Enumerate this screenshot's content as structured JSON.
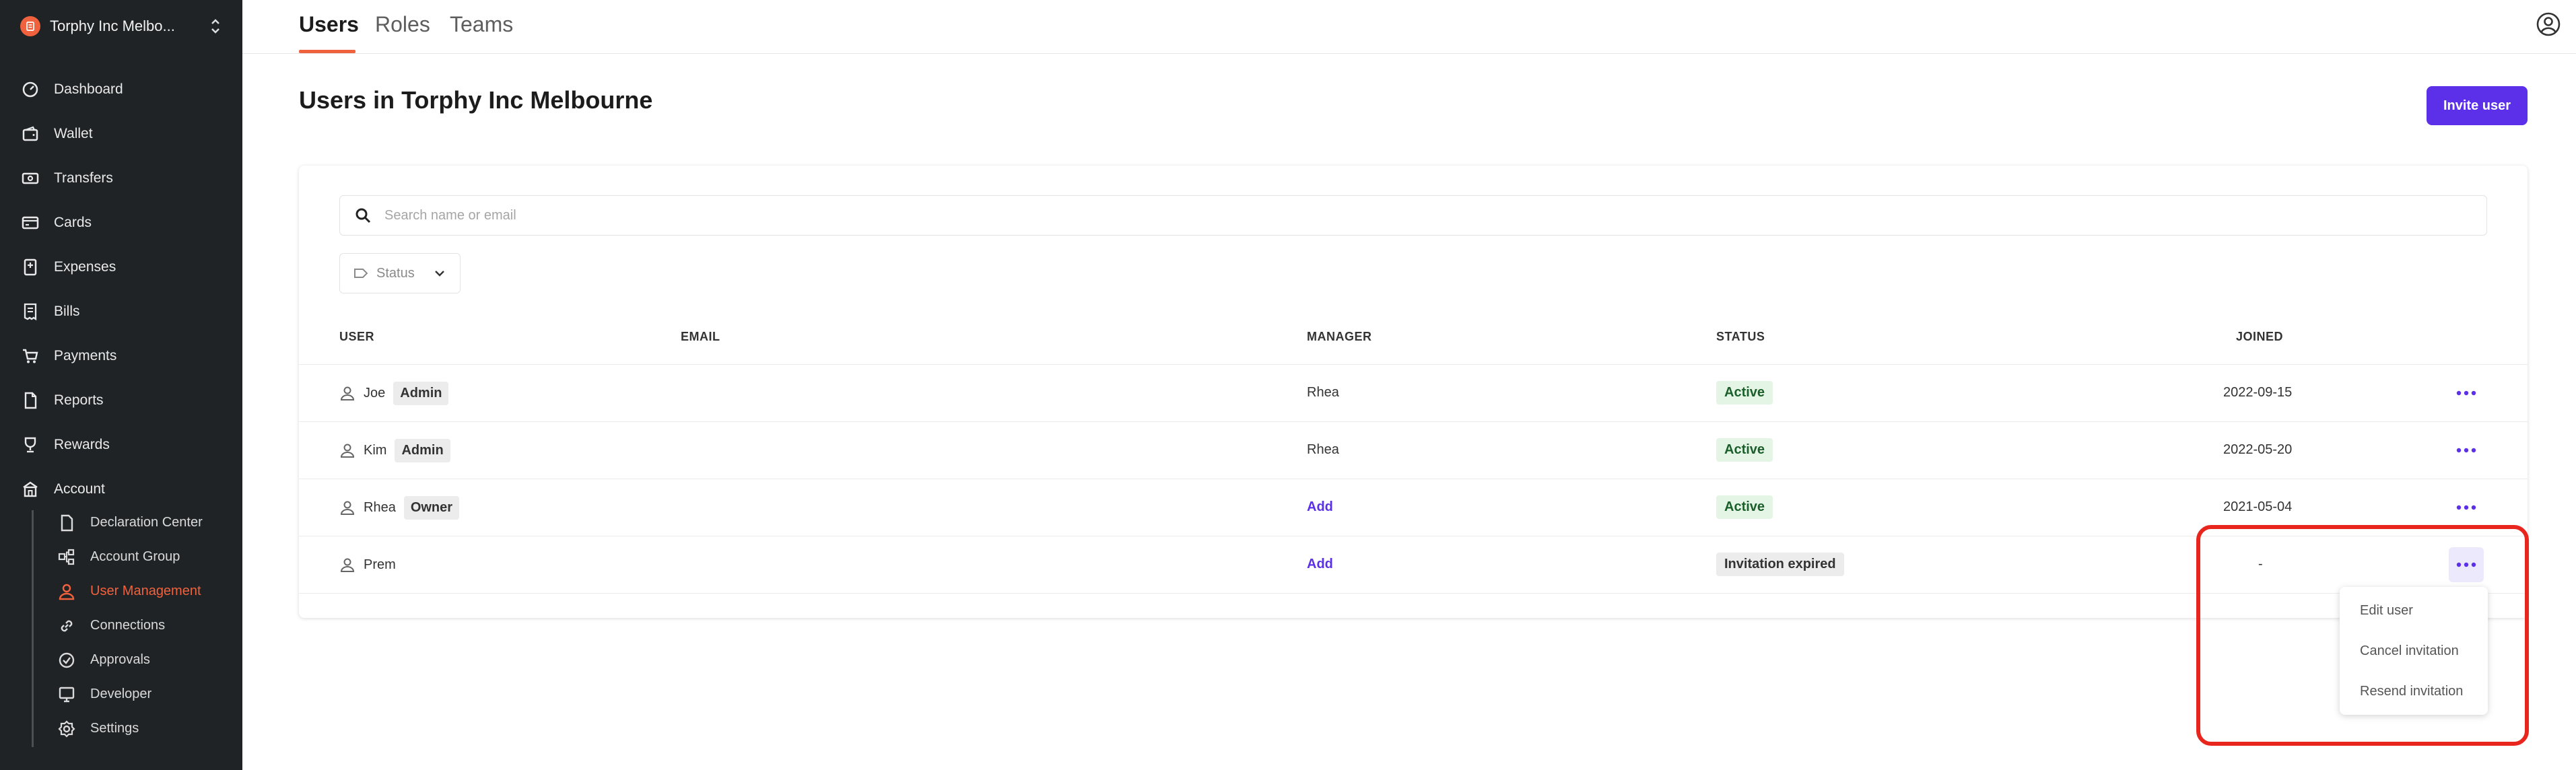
{
  "sidebar": {
    "org_name": "Torphy Inc Melbo...",
    "nav": [
      {
        "label": "Dashboard",
        "icon": "dashboard-icon"
      },
      {
        "label": "Wallet",
        "icon": "wallet-icon"
      },
      {
        "label": "Transfers",
        "icon": "transfers-icon"
      },
      {
        "label": "Cards",
        "icon": "cards-icon"
      },
      {
        "label": "Expenses",
        "icon": "expenses-icon"
      },
      {
        "label": "Bills",
        "icon": "bills-icon"
      },
      {
        "label": "Payments",
        "icon": "payments-icon"
      },
      {
        "label": "Reports",
        "icon": "reports-icon"
      },
      {
        "label": "Rewards",
        "icon": "rewards-icon"
      },
      {
        "label": "Account",
        "icon": "account-icon"
      }
    ],
    "sub_nav": [
      {
        "label": "Declaration Center",
        "icon": "document-icon"
      },
      {
        "label": "Account Group",
        "icon": "group-icon"
      },
      {
        "label": "User Management",
        "icon": "user-icon",
        "active": true
      },
      {
        "label": "Connections",
        "icon": "link-icon"
      },
      {
        "label": "Approvals",
        "icon": "check-circle-icon"
      },
      {
        "label": "Developer",
        "icon": "monitor-icon"
      },
      {
        "label": "Settings",
        "icon": "gear-icon"
      }
    ]
  },
  "tabs": [
    "Users",
    "Roles",
    "Teams"
  ],
  "page_title": "Users in Torphy Inc Melbourne",
  "invite_label": "Invite user",
  "search": {
    "placeholder": "Search name or email"
  },
  "status_filter": {
    "label": "Status"
  },
  "table": {
    "headers": {
      "user": "USER",
      "email": "EMAIL",
      "manager": "MANAGER",
      "status": "STATUS",
      "joined": "JOINED"
    },
    "rows": [
      {
        "name": "Joe",
        "role": "Admin",
        "email": "",
        "manager": "Rhea",
        "status": "Active",
        "joined": "2022-09-15"
      },
      {
        "name": "Kim",
        "role": "Admin",
        "email": "",
        "manager": "Rhea",
        "status": "Active",
        "joined": "2022-05-20"
      },
      {
        "name": "Rhea",
        "role": "Owner",
        "email": "",
        "manager": "Add",
        "status": "Active",
        "joined": "2021-05-04"
      },
      {
        "name": "Prem",
        "role": "",
        "email": "",
        "manager": "Add",
        "status": "Invitation expired",
        "joined": "-"
      }
    ]
  },
  "menu": [
    "Edit user",
    "Cancel invitation",
    "Resend invitation"
  ],
  "colors": {
    "accent": "#f0623d",
    "primary": "#5b30e8",
    "highlight": "#e8261d",
    "sidebar": "#1f2326"
  }
}
